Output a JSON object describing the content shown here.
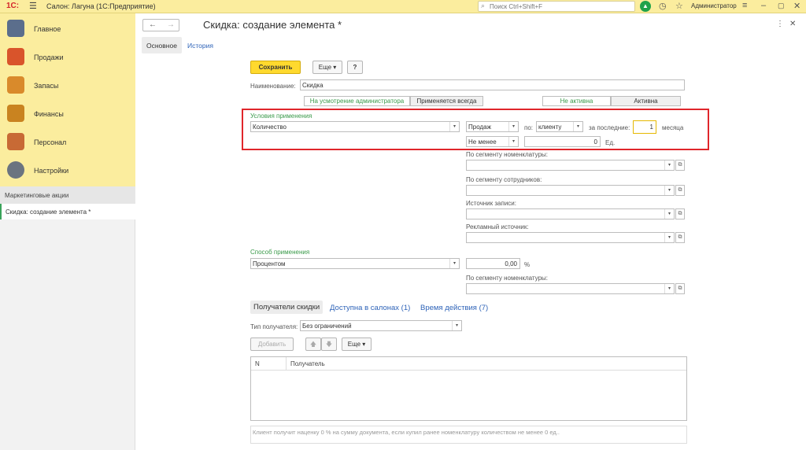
{
  "topbar": {
    "logo": "1С:",
    "title": "Салон: Лагуна  (1С:Предприятие)",
    "search_placeholder": "Поиск Ctrl+Shift+F",
    "user": "Администратор"
  },
  "sidebar": {
    "items": [
      {
        "label": "Главное",
        "icon": "clipboard-icon",
        "color": "#5b6e8c"
      },
      {
        "label": "Продажи",
        "icon": "chart-icon",
        "color": "#d9542b"
      },
      {
        "label": "Запасы",
        "icon": "box-icon",
        "color": "#d98a2b"
      },
      {
        "label": "Финансы",
        "icon": "wallet-icon",
        "color": "#c98320"
      },
      {
        "label": "Персонал",
        "icon": "people-icon",
        "color": "#c86a35"
      },
      {
        "label": "Настройки",
        "icon": "gear-icon",
        "color": "#6b7480"
      }
    ],
    "section": "Маркетинговые акции",
    "open_window": "Скидка: создание элемента *"
  },
  "form": {
    "title": "Скидка: создание элемента *",
    "tabs": {
      "main": "Основное",
      "history": "История"
    },
    "buttons": {
      "save": "Сохранить",
      "more": "Еще",
      "help": "?"
    },
    "name_label": "Наименование:",
    "name_value": "Скидка",
    "mode_toggle": [
      "На усмотрение администратора",
      "Применяется всегда"
    ],
    "status_toggle": [
      "Не активна",
      "Активна"
    ],
    "conditions": {
      "group_label": "Условия применения",
      "kind": "Количество",
      "sales": "Продаж",
      "by_label": "по:",
      "by_value": "клиенту",
      "last_label": "за последние:",
      "last_value": "1",
      "months": "месяца",
      "comparison": "Не менее",
      "quantity": "0",
      "unit": "Ед."
    },
    "filters": [
      {
        "label": "По сегменту номенклатуры:",
        "value": ""
      },
      {
        "label": "По сегменту сотрудников:",
        "value": ""
      },
      {
        "label": "Источник записи:",
        "value": ""
      },
      {
        "label": "Рекламный источник:",
        "value": ""
      }
    ],
    "method": {
      "group_label": "Способ применения",
      "value": "Процентом",
      "amount": "0,00",
      "percent": "%",
      "segment_label": "По сегменту номенклатуры:",
      "segment_value": ""
    },
    "subtabs": [
      "Получатели скидки",
      "Доступна в салонах (1)",
      "Время действия (7)"
    ],
    "recipient_type_label": "Тип получателя:",
    "recipient_type_value": "Без ограничений",
    "table_buttons": {
      "add": "Добавить",
      "more": "Еще"
    },
    "table_headers": [
      "N",
      "Получатель"
    ],
    "footer_note": "Клиент получит наценку 0 % на сумму документа, если купил ранее номенклатуру количеством не менее 0 ед.."
  }
}
